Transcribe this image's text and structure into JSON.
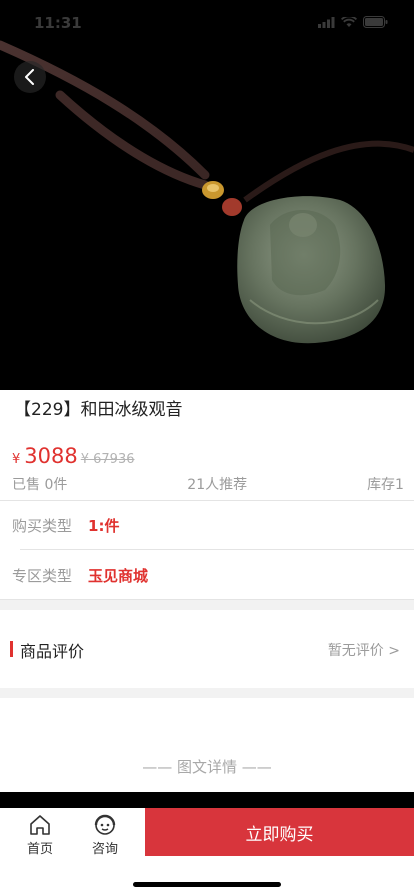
{
  "status_bar": {
    "time": "11:31",
    "icons": [
      "signal-icon",
      "wifi-icon",
      "battery-icon"
    ]
  },
  "nav": {
    "back_icon": "chevron-left-icon"
  },
  "product": {
    "title": "【229】和田冰级观音",
    "price_symbol": "¥",
    "price": "3088",
    "original_price": "¥ 67936",
    "sold": "已售 0件",
    "recommend": "21人推荐",
    "stock": "库存1"
  },
  "fields": [
    {
      "label": "购买类型",
      "value": "1:件"
    },
    {
      "label": "专区类型",
      "value": "玉见商城"
    }
  ],
  "review": {
    "label": "商品评价",
    "status": "暂无评价 >"
  },
  "details_header": "—— 图文详情 ——",
  "bottom_bar": {
    "home_label": "首页",
    "consult_label": "咨询",
    "buy_label": "立即购买"
  },
  "colors": {
    "accent": "#e0322f",
    "buy_button": "#d8353c"
  }
}
